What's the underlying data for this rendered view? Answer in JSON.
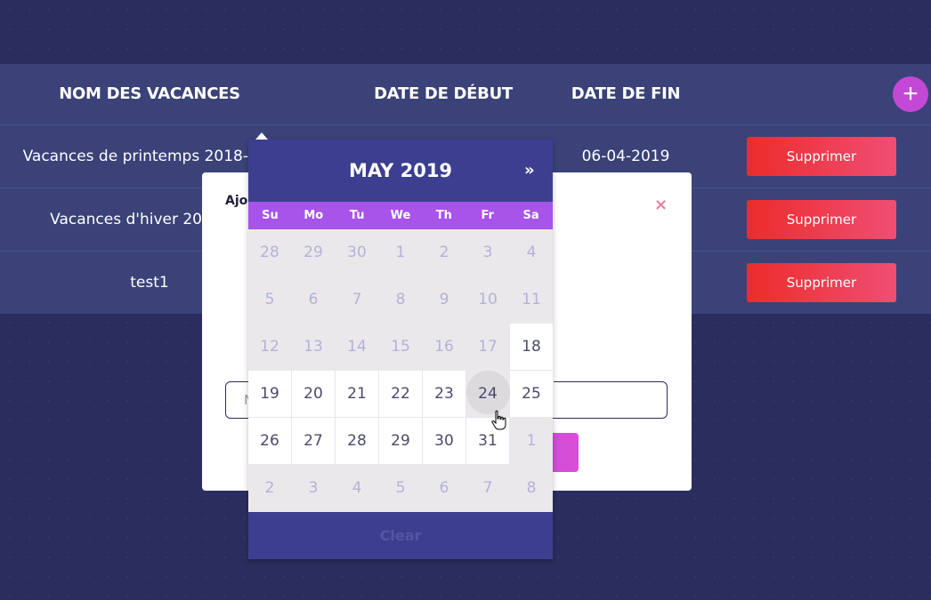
{
  "table": {
    "headers": {
      "name": "NOM DES VACANCES",
      "start": "DATE DE DÉBUT",
      "end": "DATE DE FIN"
    },
    "rows": [
      {
        "name": "Vacances de printemps 2018-",
        "end": "06-04-2019",
        "delete_label": "Supprimer"
      },
      {
        "name": "Vacances d'hiver 20",
        "end": "",
        "delete_label": "Supprimer"
      },
      {
        "name": "test1",
        "end": "",
        "delete_label": "Supprimer"
      }
    ],
    "add_button": "+"
  },
  "modal": {
    "title": "Ajo",
    "close": "×",
    "input_placeholder": "N",
    "submit_label": ""
  },
  "datepicker": {
    "title": "MAY 2019",
    "next": "»",
    "weekdays": [
      "Su",
      "Mo",
      "Tu",
      "We",
      "Th",
      "Fr",
      "Sa"
    ],
    "weeks": [
      [
        {
          "d": "28",
          "active": false
        },
        {
          "d": "29",
          "active": false
        },
        {
          "d": "30",
          "active": false
        },
        {
          "d": "1",
          "active": false
        },
        {
          "d": "2",
          "active": false
        },
        {
          "d": "3",
          "active": false
        },
        {
          "d": "4",
          "active": false
        }
      ],
      [
        {
          "d": "5",
          "active": false
        },
        {
          "d": "6",
          "active": false
        },
        {
          "d": "7",
          "active": false
        },
        {
          "d": "8",
          "active": false
        },
        {
          "d": "9",
          "active": false
        },
        {
          "d": "10",
          "active": false
        },
        {
          "d": "11",
          "active": false
        }
      ],
      [
        {
          "d": "12",
          "active": false
        },
        {
          "d": "13",
          "active": false
        },
        {
          "d": "14",
          "active": false
        },
        {
          "d": "15",
          "active": false
        },
        {
          "d": "16",
          "active": false
        },
        {
          "d": "17",
          "active": false
        },
        {
          "d": "18",
          "active": true
        }
      ],
      [
        {
          "d": "19",
          "active": true
        },
        {
          "d": "20",
          "active": true
        },
        {
          "d": "21",
          "active": true
        },
        {
          "d": "22",
          "active": true
        },
        {
          "d": "23",
          "active": true
        },
        {
          "d": "24",
          "active": true,
          "hover": true
        },
        {
          "d": "25",
          "active": true
        }
      ],
      [
        {
          "d": "26",
          "active": true
        },
        {
          "d": "27",
          "active": true
        },
        {
          "d": "28",
          "active": true
        },
        {
          "d": "29",
          "active": true
        },
        {
          "d": "30",
          "active": true
        },
        {
          "d": "31",
          "active": true
        },
        {
          "d": "1",
          "active": false
        }
      ],
      [
        {
          "d": "2",
          "active": false
        },
        {
          "d": "3",
          "active": false
        },
        {
          "d": "4",
          "active": false
        },
        {
          "d": "5",
          "active": false
        },
        {
          "d": "6",
          "active": false
        },
        {
          "d": "7",
          "active": false
        },
        {
          "d": "8",
          "active": false
        }
      ]
    ],
    "clear_label": "Clear"
  },
  "colors": {
    "background": "#2a2d5e",
    "table_bg": "#3a4278",
    "delete_button": "#ec2c2c",
    "accent_purple": "#a853e9",
    "datepicker_header": "#3c3f8f",
    "add_button": "#c348d6"
  }
}
